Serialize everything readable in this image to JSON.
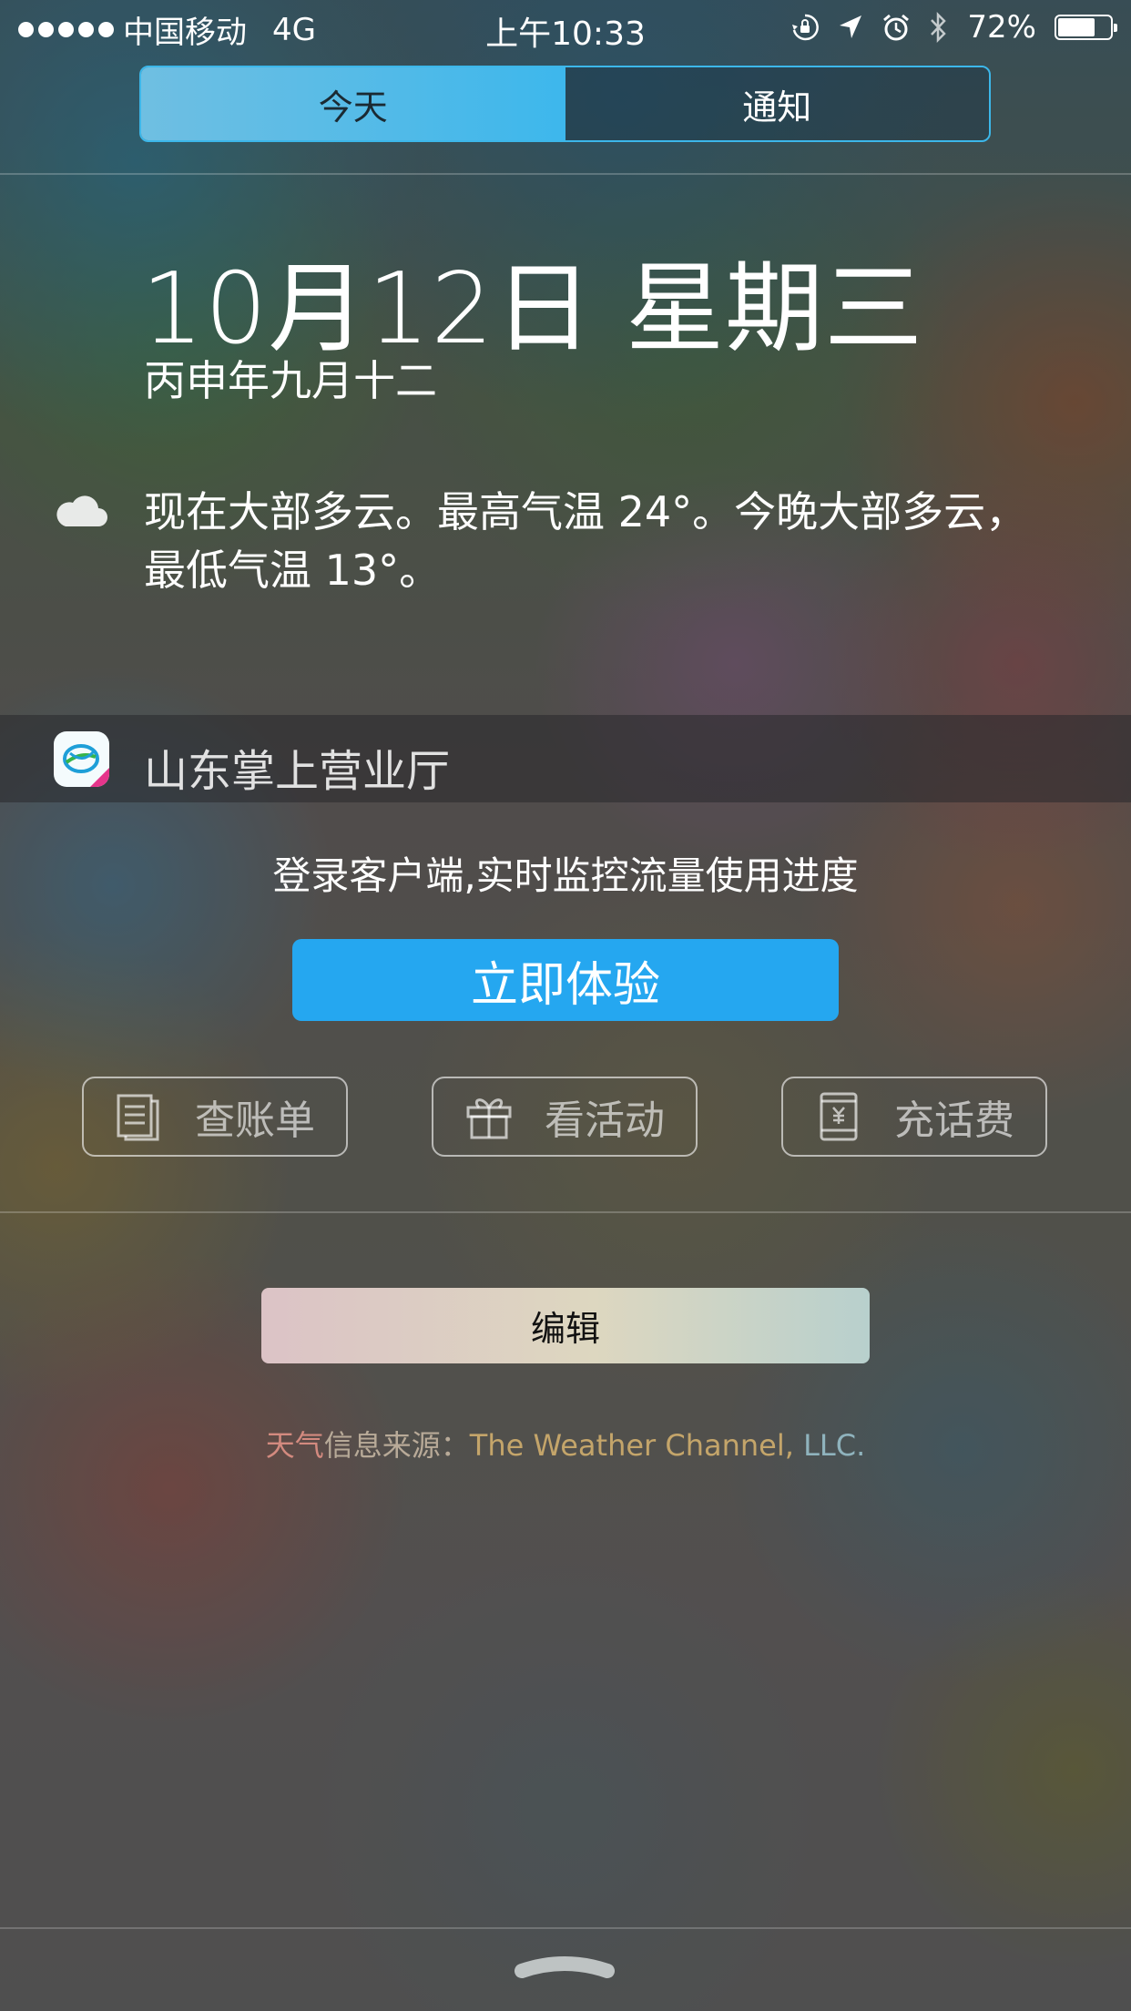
{
  "status_bar": {
    "carrier": "中国移动",
    "network": "4G",
    "time": "上午10:33",
    "battery_percent": "72%",
    "battery_level": 0.72,
    "icons": [
      "signal-dots-icon",
      "orientation-lock-icon",
      "location-arrow-icon",
      "alarm-clock-icon",
      "bluetooth-icon",
      "battery-icon"
    ]
  },
  "segments": {
    "today": "今天",
    "notifications": "通知",
    "selected": "today"
  },
  "date": {
    "main": "10月12日 星期三",
    "lunar": "丙申年九月十二"
  },
  "weather": {
    "icon": "cloud-icon",
    "summary": "现在大部多云。最高气温 24°。今晚大部多云，最低气温 13°。"
  },
  "widget": {
    "app_name": "山东掌上营业厅",
    "app_icon": "china-mobile-app-icon",
    "promo_text": "登录客户端,实时监控流量使用进度",
    "cta_label": "立即体验",
    "actions": [
      {
        "label": "查账单",
        "icon": "bill-icon"
      },
      {
        "label": "看活动",
        "icon": "gift-icon"
      },
      {
        "label": "充话费",
        "icon": "phone-recharge-icon"
      }
    ]
  },
  "edit_label": "编辑",
  "source": {
    "part1": "天气",
    "part2": "信息来源：",
    "part3": "The Weather Channel,",
    "part4": " LLC."
  },
  "colors": {
    "accent": "#25a7f0",
    "segment_active": "#3db7ec"
  }
}
